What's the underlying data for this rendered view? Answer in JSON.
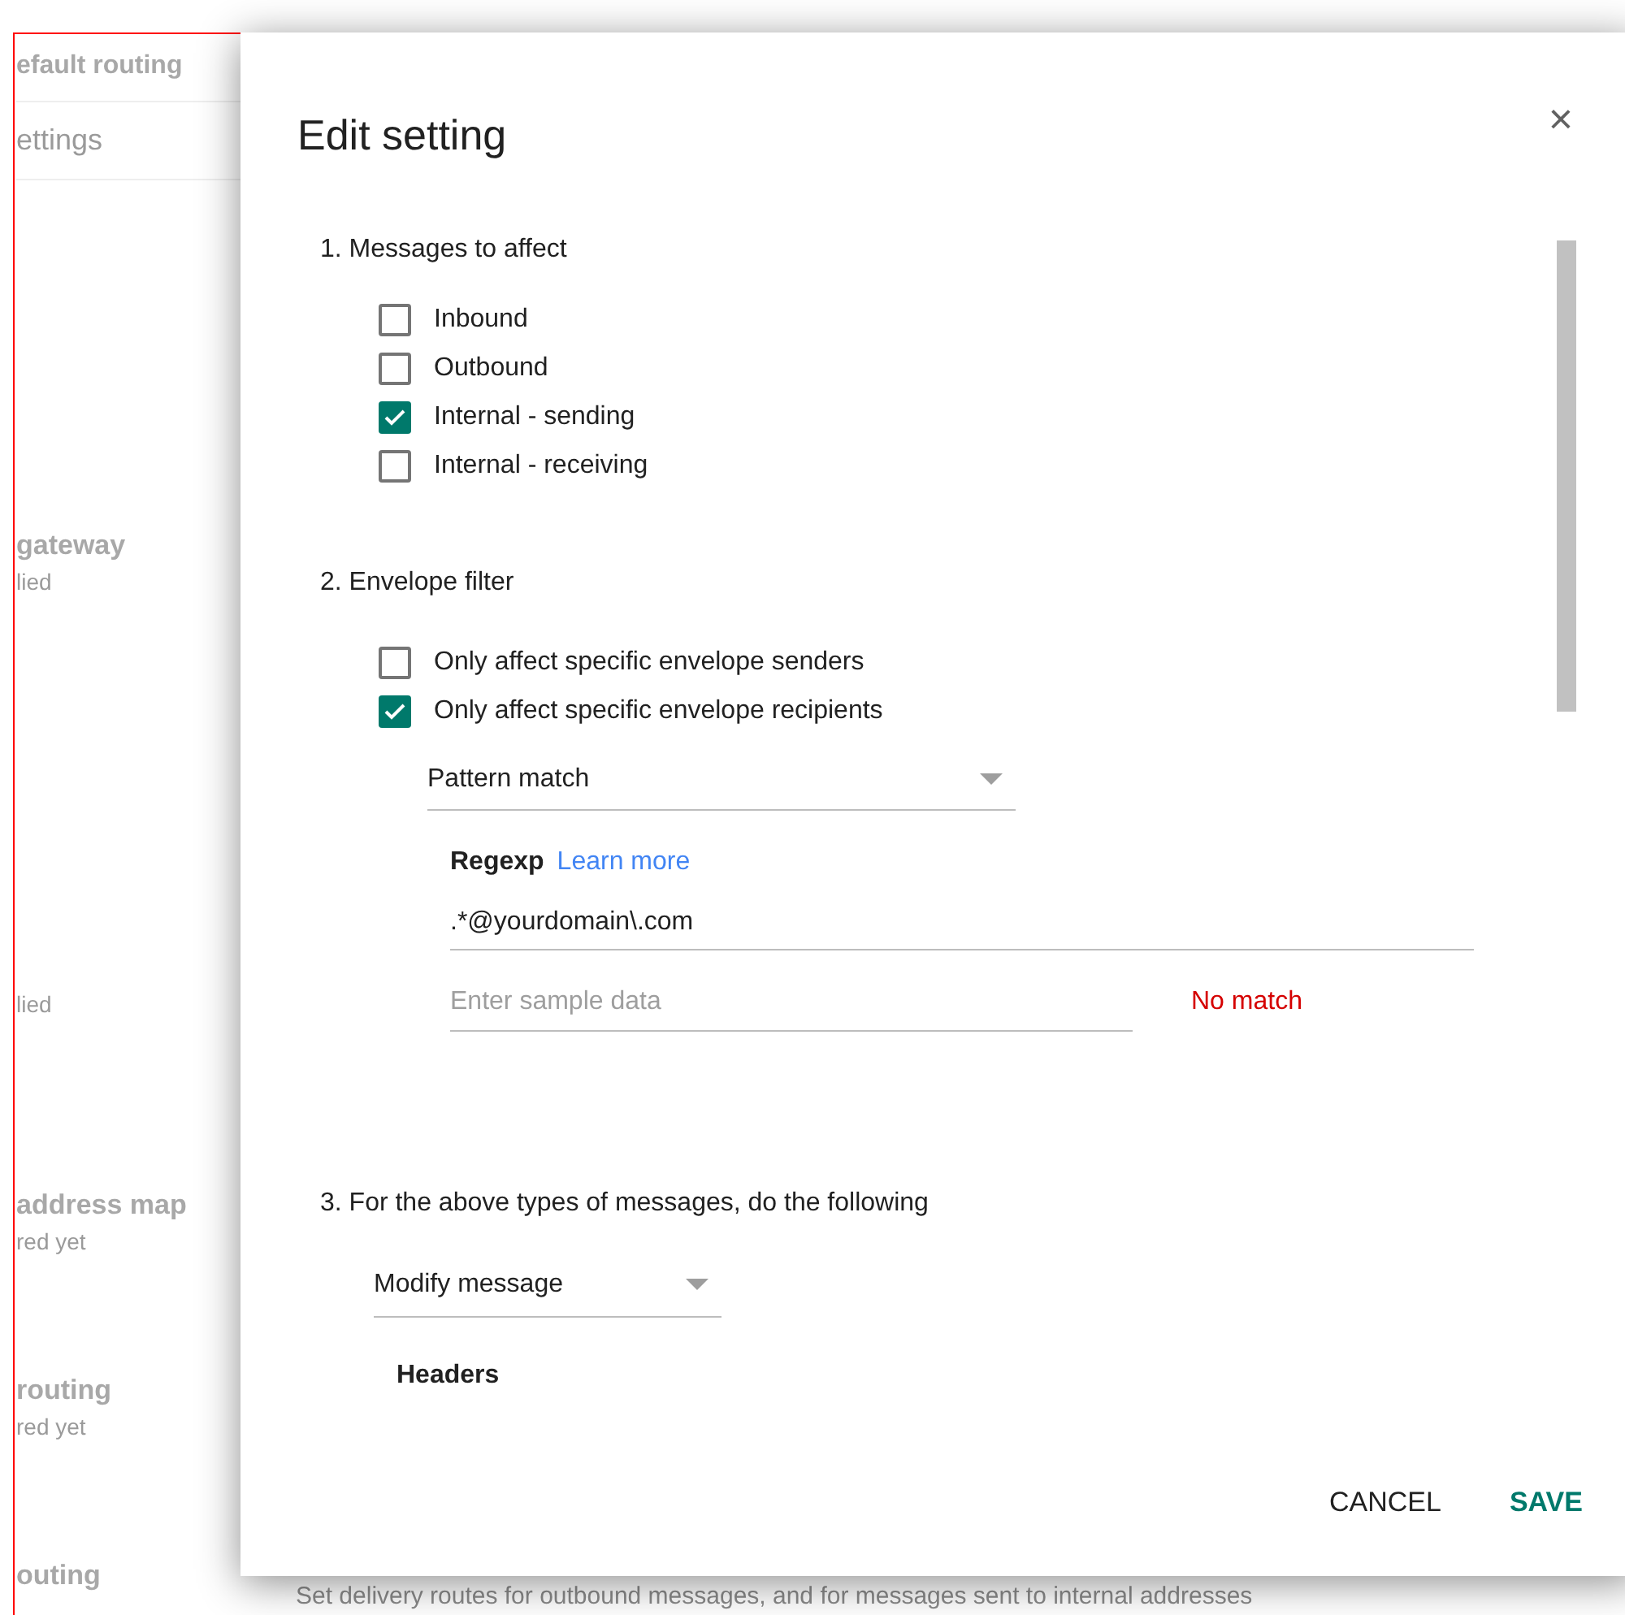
{
  "background": {
    "tab": "efault routing",
    "subtab": "ettings",
    "items": [
      {
        "title": "gateway",
        "subtitle": "lied"
      },
      {
        "subtitle": "lied"
      },
      {
        "title": "address map",
        "subtitle": "red yet"
      },
      {
        "title": "routing",
        "subtitle": "red yet"
      },
      {
        "title": "outing"
      }
    ],
    "description": "Set delivery routes for outbound messages, and for messages sent to internal addresses"
  },
  "dialog": {
    "title": "Edit setting",
    "close": "×",
    "section1": {
      "heading": "1. Messages to affect",
      "options": [
        {
          "label": "Inbound",
          "checked": false
        },
        {
          "label": "Outbound",
          "checked": false
        },
        {
          "label": "Internal - sending",
          "checked": true
        },
        {
          "label": "Internal - receiving",
          "checked": false
        }
      ]
    },
    "section2": {
      "heading": "2. Envelope filter",
      "options": [
        {
          "label": "Only affect specific envelope senders",
          "checked": false
        },
        {
          "label": "Only affect specific envelope recipients",
          "checked": true
        }
      ],
      "match_type": "Pattern match",
      "regexp_label": "Regexp",
      "learn_more": "Learn more",
      "regexp_value": ".*@yourdomain\\.com",
      "sample_placeholder": "Enter sample data",
      "match_result": "No match"
    },
    "section3": {
      "heading": "3. For the above types of messages, do the following",
      "action": "Modify message",
      "subheading": "Headers"
    },
    "buttons": [
      {
        "label": "CANCEL",
        "kind": "secondary"
      },
      {
        "label": "SAVE",
        "kind": "primary"
      }
    ]
  }
}
